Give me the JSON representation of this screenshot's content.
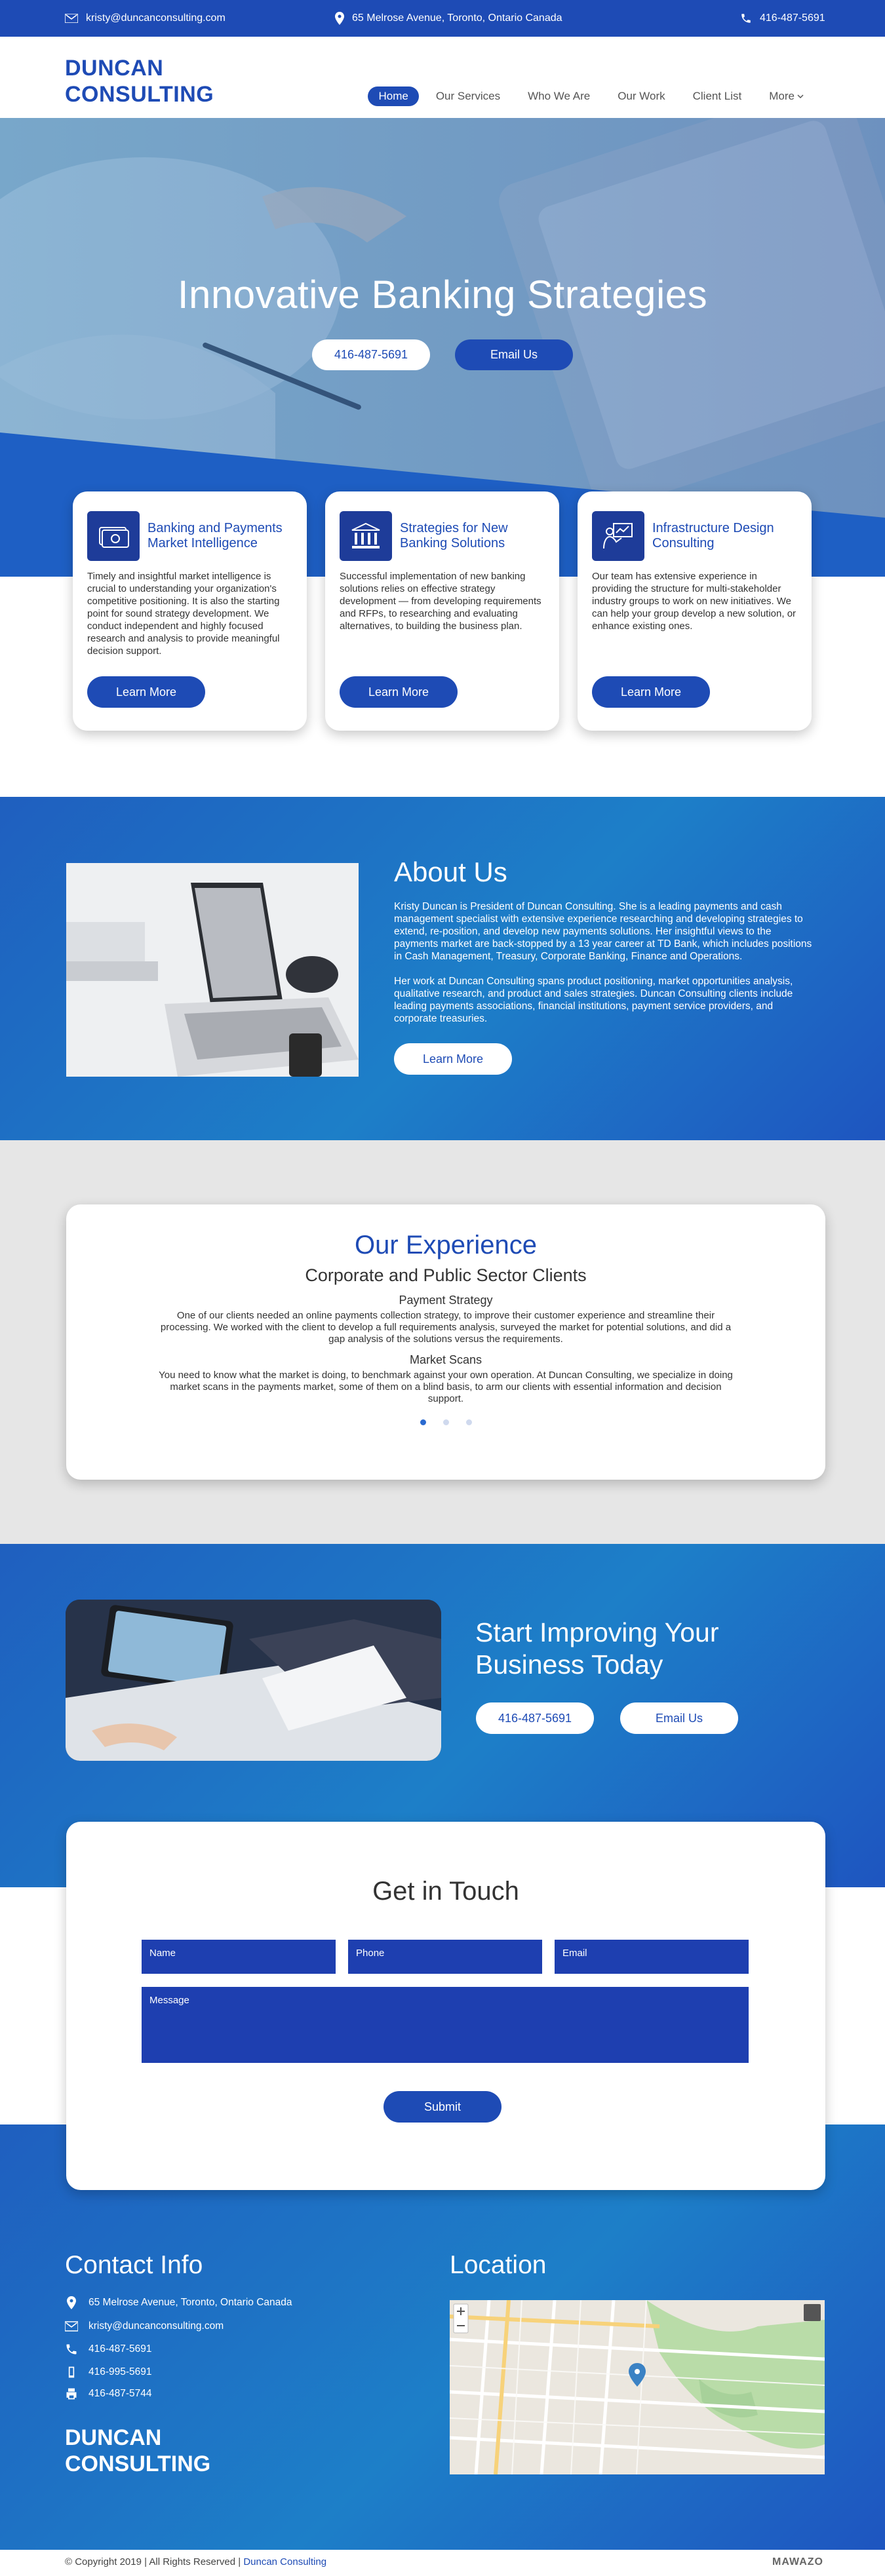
{
  "topbar": {
    "email": "kristy@duncanconsulting.com",
    "address": "65 Melrose Avenue, Toronto, Ontario Canada",
    "phone": "416-487-5691"
  },
  "brand": {
    "line1": "DUNCAN",
    "line2": "CONSULTING"
  },
  "nav": {
    "items": [
      "Home",
      "Our Services",
      "Who We Are",
      "Our Work",
      "Client List"
    ],
    "more": "More"
  },
  "hero": {
    "title": "Innovative Banking Strategies",
    "phone_button": "416-487-5691",
    "email_button": "Email Us"
  },
  "services": [
    {
      "title": "Banking and Payments Market Intelligence",
      "text": "Timely and insightful market intelligence is crucial to understanding your organization's competitive positioning. It is also the starting point for sound strategy development. We conduct independent and highly focused research and analysis to provide meaningful decision support.",
      "button": "Learn More"
    },
    {
      "title": "Strategies for New Banking Solutions",
      "text": "Successful implementation of new banking solutions relies on effective strategy development — from developing requirements and RFPs, to researching and evaluating alternatives, to building the business plan.",
      "button": "Learn More"
    },
    {
      "title": "Infrastructure Design Consulting",
      "text": "Our team has extensive experience in providing the structure for multi-stakeholder industry groups to work on new initiatives. We can help your group develop a new solution, or enhance existing ones.",
      "button": "Learn More"
    }
  ],
  "about": {
    "title": "About Us",
    "p1": "Kristy Duncan is President of Duncan Consulting. She is a leading payments and cash management specialist with extensive experience researching and developing strategies to extend, re-position, and develop new payments solutions. Her insightful views to the payments market are back-stopped by a 13 year career at TD Bank, which includes positions in Cash Management, Treasury, Corporate Banking, Finance and Operations.",
    "p2": "Her work at Duncan Consulting spans product positioning, market opportunities analysis, qualitative research, and product and sales strategies. Duncan Consulting clients include leading payments associations, financial institutions, payment service providers, and corporate treasuries.",
    "button": "Learn More"
  },
  "experience": {
    "title": "Our Experience",
    "subtitle": "Corporate and Public Sector Clients",
    "items": [
      {
        "heading": "Payment Strategy",
        "text": "One of our clients needed an online payments collection strategy, to improve their customer experience and streamline their processing. We worked with the client to develop a full requirements analysis, surveyed the market for potential solutions, and did a gap analysis of the solutions versus the requirements."
      },
      {
        "heading": "Market Scans",
        "text": "You need to know what the market is doing, to benchmark against your own operation. At Duncan Consulting, we specialize in doing market scans in the payments market, some of them on a blind basis, to arm our clients with essential information and decision support."
      }
    ]
  },
  "cta": {
    "title": "Start Improving Your Business Today",
    "phone_button": "416-487-5691",
    "email_button": "Email Us"
  },
  "contact_form": {
    "title": "Get in Touch",
    "name_placeholder": "Name",
    "phone_placeholder": "Phone",
    "email_placeholder": "Email",
    "message_placeholder": "Message",
    "submit": "Submit"
  },
  "footer": {
    "contact_title": "Contact Info",
    "address": "65 Melrose Avenue, Toronto, Ontario Canada",
    "email": "kristy@duncanconsulting.com",
    "phone1": "416-487-5691",
    "phone2": "416-995-5691",
    "fax": "416-487-5744",
    "location_title": "Location",
    "copyright": "© Copyright 2019 | All Rights Reserved | ",
    "copyright_link": "Duncan Consulting",
    "credit": "MAWAZO"
  }
}
